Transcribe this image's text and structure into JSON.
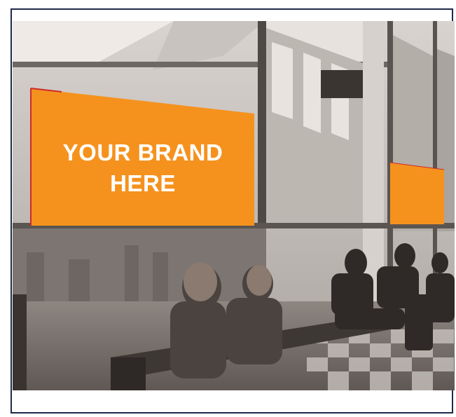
{
  "billboard": {
    "line1": "YOUR BRAND",
    "line2": "HERE",
    "panel_color": "#f5921e"
  },
  "photo": {
    "subject": "station-waiting-area-photo",
    "tone": "sepia"
  }
}
